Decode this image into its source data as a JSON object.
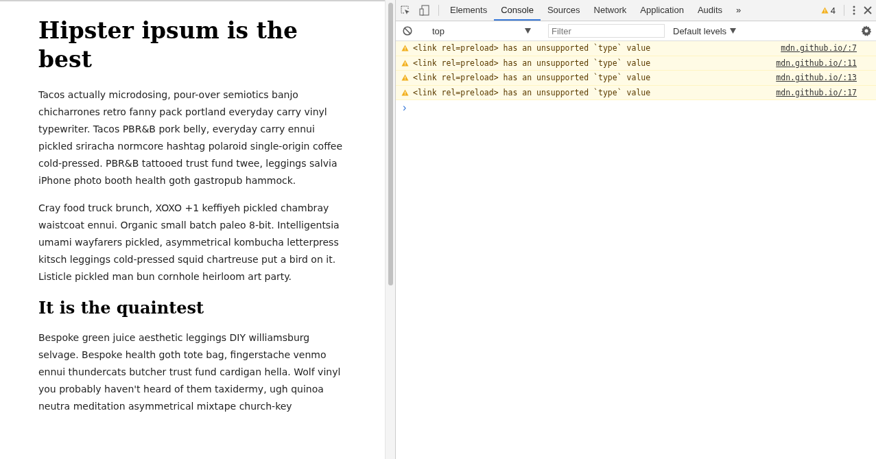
{
  "article": {
    "blocks": [
      {
        "kind": "h1",
        "text": "Hipster ipsum is the best"
      },
      {
        "kind": "p",
        "text": "Tacos actually microdosing, pour-over semiotics banjo chicharrones retro fanny pack portland everyday carry vinyl typewriter. Tacos PBR&B pork belly, everyday carry ennui pickled sriracha normcore hashtag polaroid single-origin coffee cold-pressed. PBR&B tattooed trust fund twee, leggings salvia iPhone photo booth health goth gastropub hammock."
      },
      {
        "kind": "p",
        "text": "Cray food truck brunch, XOXO +1 keffiyeh pickled chambray waistcoat ennui. Organic small batch paleo 8-bit. Intelligentsia umami wayfarers pickled, asymmetrical kombucha letterpress kitsch leggings cold-pressed squid chartreuse put a bird on it. Listicle pickled man bun cornhole heirloom art party."
      },
      {
        "kind": "h2",
        "text": "It is the quaintest"
      },
      {
        "kind": "p",
        "text": "Bespoke green juice aesthetic leggings DIY williamsburg selvage. Bespoke health goth tote bag, fingerstache venmo ennui thundercats butcher trust fund cardigan hella. Wolf vinyl you probably haven't heard of them taxidermy, ugh quinoa neutra meditation asymmetrical mixtape church-key"
      }
    ]
  },
  "devtools": {
    "tabs": [
      {
        "label": "Elements",
        "selected": false
      },
      {
        "label": "Console",
        "selected": true
      },
      {
        "label": "Sources",
        "selected": false
      },
      {
        "label": "Network",
        "selected": false
      },
      {
        "label": "Application",
        "selected": false
      },
      {
        "label": "Audits",
        "selected": false
      }
    ],
    "more_tabs": "»",
    "warning_count": "4",
    "context": "top",
    "filter": {
      "placeholder": "Filter"
    },
    "levels": "Default levels",
    "messages": [
      {
        "kind": "warning",
        "text": "<link rel=preload> has an unsupported `type` value",
        "source": "mdn.github.io/:7"
      },
      {
        "kind": "warning",
        "text": "<link rel=preload> has an unsupported `type` value",
        "source": "mdn.github.io/:11"
      },
      {
        "kind": "warning",
        "text": "<link rel=preload> has an unsupported `type` value",
        "source": "mdn.github.io/:13"
      },
      {
        "kind": "warning",
        "text": "<link rel=preload> has an unsupported `type` value",
        "source": "mdn.github.io/:17"
      }
    ],
    "prompt": "›"
  }
}
